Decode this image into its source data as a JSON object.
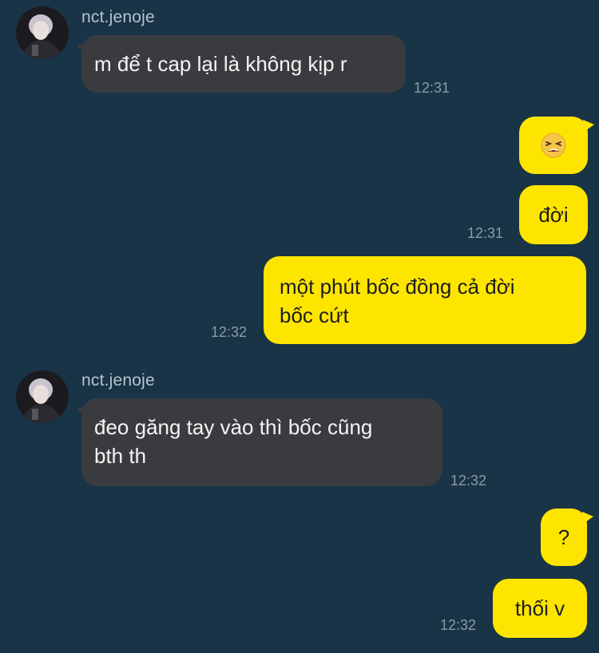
{
  "colors": {
    "background": "#183446",
    "incoming_bubble": "#3a3b3f",
    "outgoing_bubble": "#fde500",
    "timestamp": "#8e9ba6",
    "sender_name": "#b7c3cc"
  },
  "messages": {
    "group1": {
      "sender": "nct.jenoje",
      "avatar_icon": "profile-photo",
      "text": "m để t cap lại là không kịp r",
      "time": "12:31"
    },
    "out1": {
      "emoji_icon": "tired-face-emoji",
      "text2": "đời",
      "time": "12:31",
      "text3": "một phút bốc đồng cả đời\nbốc cứt",
      "time3": "12:32"
    },
    "group2": {
      "sender": "nct.jenoje",
      "avatar_icon": "profile-photo",
      "text": "đeo găng tay vào thì bốc cũng\nbth th",
      "time": "12:32"
    },
    "out2": {
      "text1": "?",
      "text2": "thối v",
      "time": "12:32"
    }
  }
}
